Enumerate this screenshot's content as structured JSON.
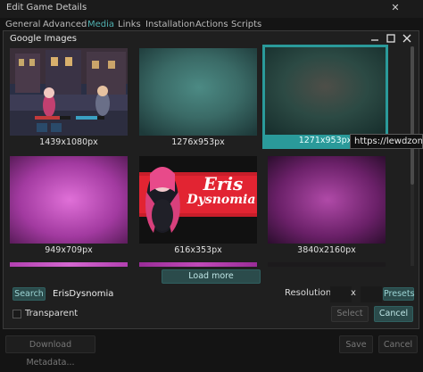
{
  "background_window": {
    "title": "Edit Game Details",
    "tabs": [
      {
        "label": "General",
        "active": false
      },
      {
        "label": "Advanced",
        "active": false
      },
      {
        "label": "Media",
        "active": true
      },
      {
        "label": "Links",
        "active": false
      },
      {
        "label": "Installation",
        "active": false
      },
      {
        "label": "Actions",
        "active": false
      },
      {
        "label": "Scripts",
        "active": false
      }
    ],
    "download_metadata_label": "Download Metadata...",
    "save_label": "Save",
    "cancel_label": "Cancel"
  },
  "dialog": {
    "title": "Google Images",
    "minimize_icon": "minimize-icon",
    "maximize_icon": "maximize-icon",
    "close_icon": "close-icon"
  },
  "images": [
    {
      "caption": "1439x1080px",
      "selected": false,
      "style": "game-scene"
    },
    {
      "caption": "1276x953px",
      "selected": false,
      "style": "teal-blur"
    },
    {
      "caption": "1271x953px",
      "selected": true,
      "style": "teal-dark-blur"
    },
    {
      "caption": "949x709px",
      "selected": false,
      "style": "magenta-blur"
    },
    {
      "caption": "616x353px",
      "selected": false,
      "style": "eris-logo"
    },
    {
      "caption": "3840x2160px",
      "selected": false,
      "style": "purple-blur"
    },
    {
      "caption": "",
      "selected": false,
      "style": "magenta-strip"
    },
    {
      "caption": "",
      "selected": false,
      "style": "magenta-strip"
    },
    {
      "caption": "",
      "selected": false,
      "style": "dark-strip"
    }
  ],
  "logo_text": {
    "line1": "Eris",
    "line2": "Dysnomia"
  },
  "tooltip": "https://lewdzone.c",
  "load_more_label": "Load more",
  "search": {
    "button_label": "Search",
    "query": "ErisDysnomia"
  },
  "resolution": {
    "label": "Resolution:",
    "width": "",
    "separator": "x",
    "height": ""
  },
  "presets_label": "Presets",
  "transparent_label": "Transparent",
  "transparent_checked": false,
  "select_label": "Select",
  "cancel_label": "Cancel",
  "colors": {
    "accent": "#2a9a9a",
    "accent_button": "#2b4b4b",
    "background": "#1f1f1f"
  }
}
